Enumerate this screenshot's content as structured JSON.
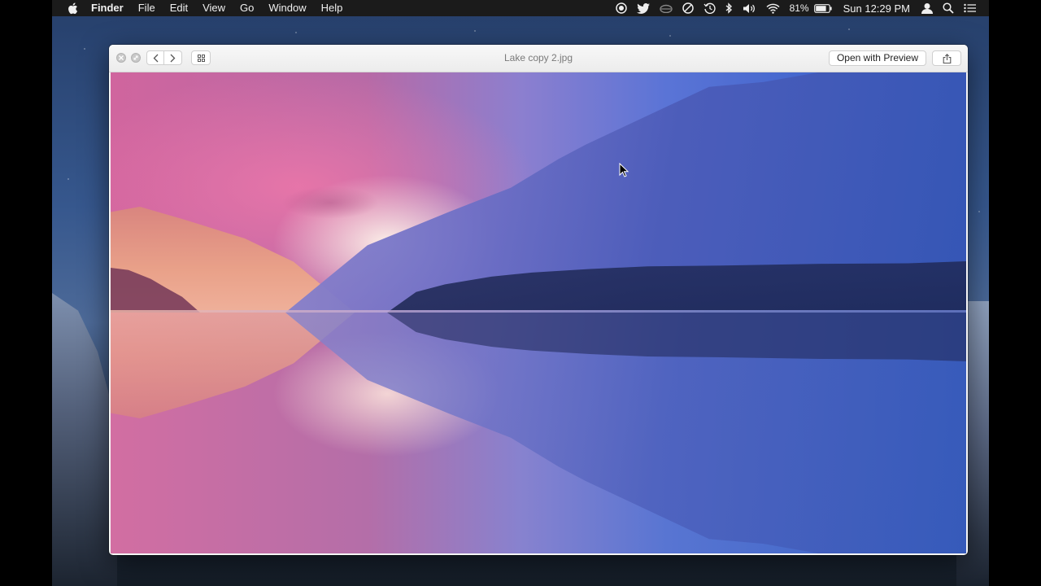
{
  "menubar": {
    "app_name": "Finder",
    "menus": [
      "File",
      "Edit",
      "View",
      "Go",
      "Window",
      "Help"
    ],
    "battery_percent": "81%",
    "clock": "Sun 12:29 PM",
    "status_icons": [
      "record-icon",
      "twitter-icon",
      "cloud-icon",
      "do-not-disturb-icon",
      "time-machine-icon",
      "bluetooth-icon",
      "volume-icon",
      "wifi-icon",
      "battery-icon",
      "user-icon",
      "spotlight-search-icon",
      "notification-center-icon"
    ]
  },
  "quicklook": {
    "title": "Lake copy 2.jpg",
    "open_button": "Open with Preview",
    "buttons": [
      "close-icon",
      "fullscreen-icon",
      "previous-icon",
      "next-icon",
      "index-sheet-icon",
      "share-icon"
    ]
  },
  "colors": {
    "menubar_bg": "#1b1b1b",
    "window_bg": "#f6f6f6",
    "title_text": "#7a7a7a"
  }
}
